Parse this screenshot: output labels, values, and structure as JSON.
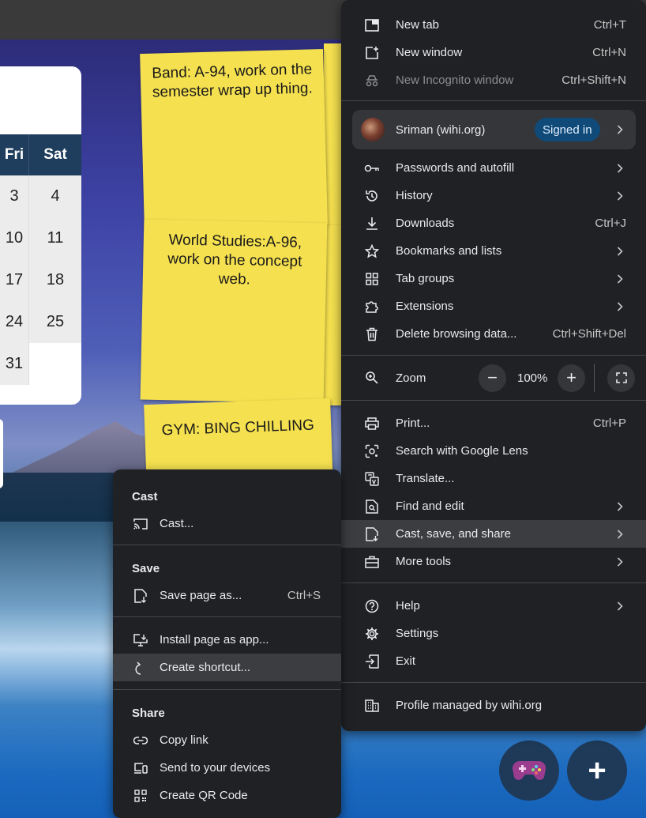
{
  "background": {
    "calendar": {
      "headers": [
        "Fri",
        "Sat"
      ],
      "rows": [
        [
          "3",
          "4"
        ],
        [
          "10",
          "11"
        ],
        [
          "17",
          "18"
        ],
        [
          "24",
          "25"
        ],
        [
          "31",
          ""
        ]
      ]
    },
    "notes": [
      "Band: A-94, work on the semester wrap up thing.",
      "World Studies:A-96, work on the concept web.",
      "GYM: BING CHILLING"
    ],
    "fab_add": "+"
  },
  "main_menu": {
    "items_top": [
      {
        "label": "New tab",
        "shortcut": "Ctrl+T",
        "icon": "new-tab-icon"
      },
      {
        "label": "New window",
        "shortcut": "Ctrl+N",
        "icon": "new-window-icon"
      },
      {
        "label": "New Incognito window",
        "shortcut": "Ctrl+Shift+N",
        "icon": "incognito-icon"
      }
    ],
    "profile": {
      "name": "Sriman (wihi.org)",
      "badge": "Signed in"
    },
    "items_mid": [
      {
        "label": "Passwords and autofill",
        "icon": "key-icon"
      },
      {
        "label": "History",
        "icon": "history-icon"
      },
      {
        "label": "Downloads",
        "shortcut": "Ctrl+J",
        "icon": "download-icon"
      },
      {
        "label": "Bookmarks and lists",
        "icon": "star-icon"
      },
      {
        "label": "Tab groups",
        "icon": "tab-groups-icon"
      },
      {
        "label": "Extensions",
        "icon": "puzzle-icon"
      },
      {
        "label": "Delete browsing data...",
        "shortcut": "Ctrl+Shift+Del",
        "icon": "trash-icon"
      }
    ],
    "zoom": {
      "label": "Zoom",
      "value": "100%",
      "minus": "−",
      "plus": "+"
    },
    "items_tools": [
      {
        "label": "Print...",
        "shortcut": "Ctrl+P",
        "icon": "printer-icon"
      },
      {
        "label": "Search with Google Lens",
        "icon": "lens-icon"
      },
      {
        "label": "Translate...",
        "icon": "translate-icon"
      },
      {
        "label": "Find and edit",
        "icon": "find-icon"
      },
      {
        "label": "Cast, save, and share",
        "icon": "cast-save-icon"
      },
      {
        "label": "More tools",
        "icon": "toolbox-icon"
      }
    ],
    "items_bottom": [
      {
        "label": "Help",
        "icon": "help-icon"
      },
      {
        "label": "Settings",
        "icon": "gear-icon"
      },
      {
        "label": "Exit",
        "icon": "exit-icon"
      }
    ],
    "managed": {
      "label": "Profile managed by wihi.org",
      "icon": "building-icon"
    }
  },
  "sub_menu": {
    "cast_header": "Cast",
    "cast_item": "Cast...",
    "save_header": "Save",
    "save_item": "Save page as...",
    "save_shortcut": "Ctrl+S",
    "install_item": "Install page as app...",
    "shortcut_item": "Create shortcut...",
    "share_header": "Share",
    "copy_link": "Copy link",
    "send_devices": "Send to your devices",
    "qr_code": "Create QR Code"
  },
  "colors": {
    "menu_bg": "#202124",
    "highlight": "#3c3d40",
    "note_yellow": "#f5e04f",
    "calendar_header": "#1f3d5c",
    "badge_bg": "#0f4a79"
  }
}
